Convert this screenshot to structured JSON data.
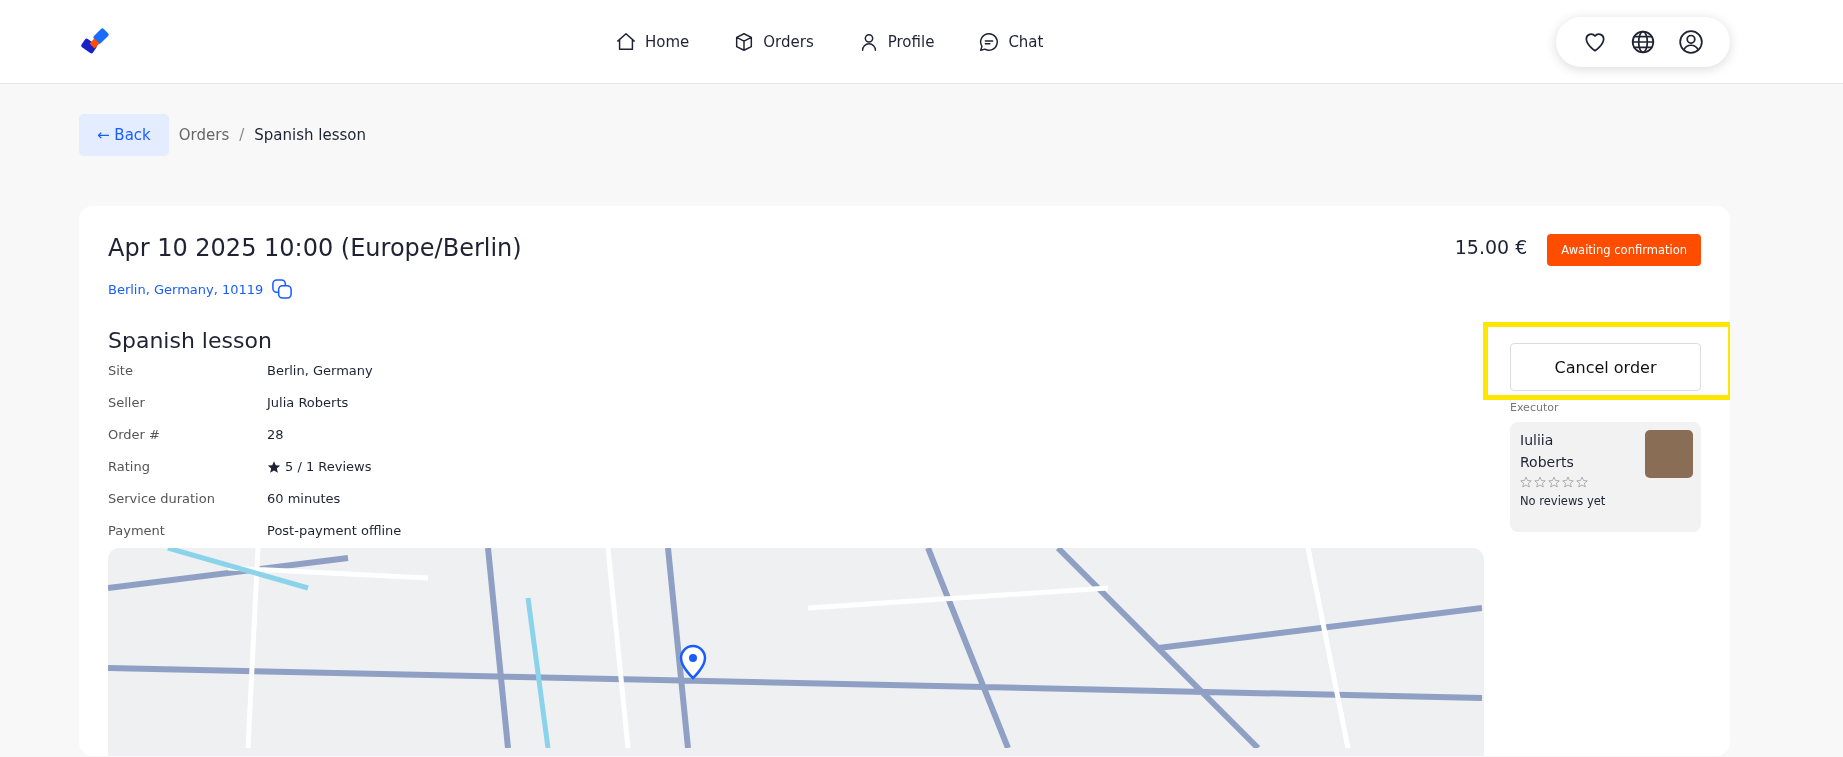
{
  "header": {
    "nav": [
      {
        "label": "Home",
        "kind": "home",
        "selected": false
      },
      {
        "label": "Orders",
        "kind": "box",
        "selected": false
      },
      {
        "label": "Profile",
        "kind": "user",
        "selected": false
      },
      {
        "label": "Chat",
        "kind": "chat",
        "selected": false
      }
    ]
  },
  "breadcrumb": {
    "back": "← Back",
    "items": [
      "Orders",
      "Spanish lesson"
    ],
    "separator": "/"
  },
  "order": {
    "datetime": "Apr 10 2025 10:00 (Europe/Berlin)",
    "address": "Berlin, Germany, 10119",
    "price": "15.00 €",
    "status": "Awaiting confirmation",
    "title": "Spanish lesson",
    "details": [
      {
        "label": "Site",
        "value": "Berlin, Germany",
        "kind": "text"
      },
      {
        "label": "Seller",
        "value": "Julia Roberts",
        "kind": "text"
      },
      {
        "label": "Order #",
        "value": "28",
        "kind": "text"
      },
      {
        "label": "Rating",
        "value": "5 / 1 Reviews",
        "kind": "rating"
      },
      {
        "label": "Service duration",
        "value": "60 minutes",
        "kind": "text"
      },
      {
        "label": "Payment",
        "value": "Post-payment offline",
        "kind": "text"
      }
    ]
  },
  "actions": {
    "cancel": "Cancel order",
    "highlighted": true
  },
  "executor": {
    "heading": "Executor",
    "first_name": "Iuliia",
    "last_name": "Roberts",
    "stars": 0,
    "reviews": "No reviews yet"
  }
}
